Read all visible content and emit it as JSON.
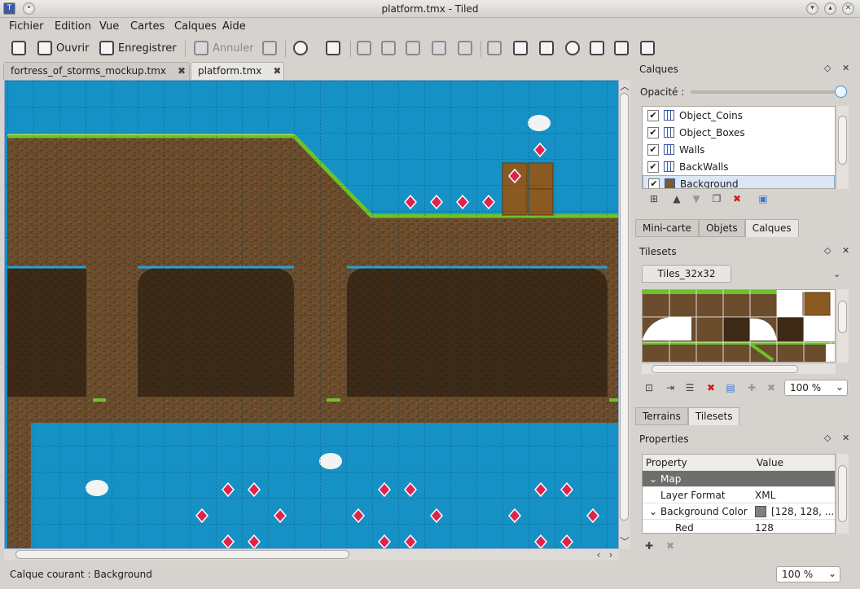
{
  "window": {
    "title": "platform.tmx - Tiled"
  },
  "menu": [
    "Fichier",
    "Edition",
    "Vue",
    "Cartes",
    "Calques",
    "Aide"
  ],
  "toolbar": {
    "new_icon": "new-map-icon",
    "open_label": "Ouvrir",
    "save_label": "Enregistrer",
    "undo_label": "Annuler"
  },
  "doc_tabs": [
    {
      "label": "fortress_of_storms_mockup.tmx"
    },
    {
      "label": "platform.tmx"
    }
  ],
  "layers_panel": {
    "title": "Calques",
    "opacity_label": "Opacité :",
    "layers": [
      {
        "name": "Object_Coins",
        "visible": true
      },
      {
        "name": "Object_Boxes",
        "visible": true
      },
      {
        "name": "Walls",
        "visible": true
      },
      {
        "name": "BackWalls",
        "visible": true
      },
      {
        "name": "Background",
        "visible": true,
        "selected": true
      }
    ],
    "tabs": [
      "Mini-carte",
      "Objets",
      "Calques"
    ]
  },
  "tilesets_panel": {
    "title": "Tilesets",
    "tileset_name": "Tiles_32x32",
    "zoom": "100 %",
    "tabs": [
      "Terrains",
      "Tilesets"
    ]
  },
  "properties_panel": {
    "title": "Properties",
    "col_property": "Property",
    "col_value": "Value",
    "section": "Map",
    "rows": [
      {
        "name": "Layer Format",
        "value": "XML"
      },
      {
        "name": "Background Color",
        "value": "[128, 128, ..."
      },
      {
        "name": "Red",
        "value": "128"
      }
    ]
  },
  "status": {
    "current_layer": "Calque courant : Background",
    "zoom": "100 %"
  },
  "colors": {
    "sky": "#1591c5",
    "dirt": "#6b4c2c",
    "grass": "#6cc22a",
    "coin": "#e0234a"
  }
}
